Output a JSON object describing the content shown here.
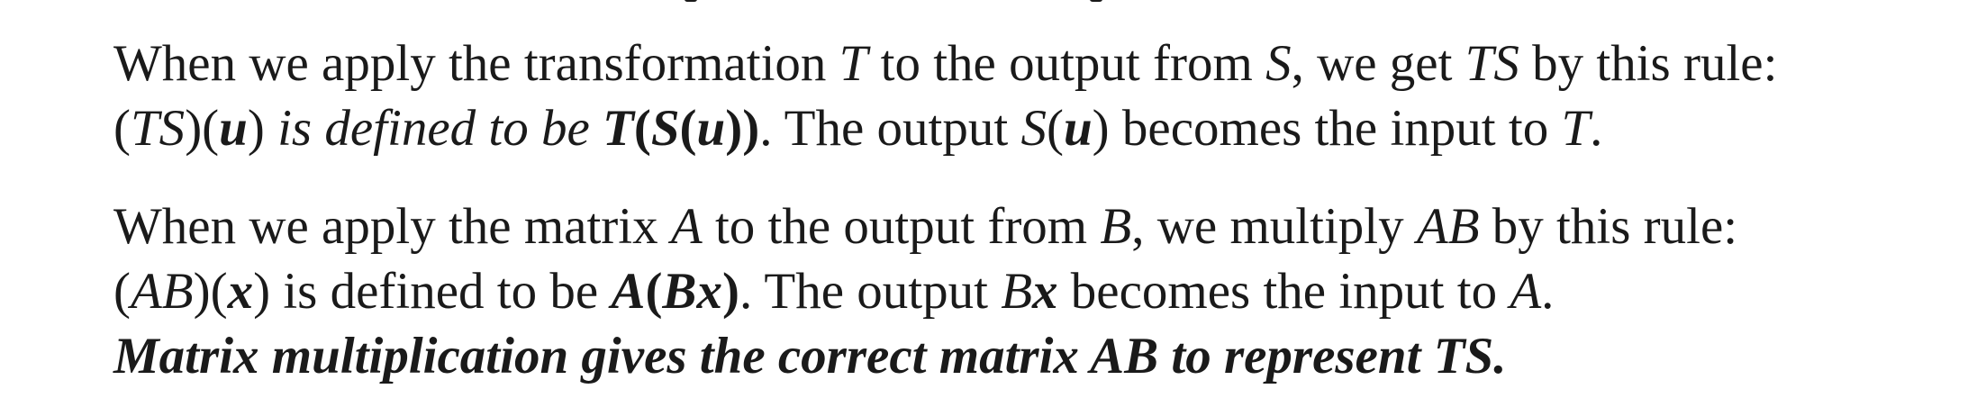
{
  "paragraph_1": {
    "line_1": {
      "a": "When we apply the transformation ",
      "T": "T",
      "b": " to the output from ",
      "S": "S",
      "c": ", we get ",
      "TS": "TS",
      "d": " by this rule:"
    },
    "line_2": {
      "paren_open": "(",
      "TS": "TS",
      "paren_close": ")(",
      "u": "u",
      "paren_end": ")",
      "defined": " is defined to be ",
      "T_bold": "T",
      "open2": "(",
      "S_bold": "S",
      "open3": "(",
      "u2": "u",
      "close3": "))",
      "rest": ". The output ",
      "S": "S",
      "open4": "(",
      "u3": "u",
      "close4": ")",
      "rest2": " becomes the input to ",
      "T": "T",
      "end": "."
    }
  },
  "paragraph_2": {
    "line_3": {
      "a": "When we apply the matrix ",
      "A": "A",
      "b": " to the output from ",
      "B": "B",
      "c": ", we multiply ",
      "AB": "AB",
      "d": " by this rule:"
    },
    "line_4": {
      "open": "(",
      "AB": "AB",
      "mid": ")(",
      "x": "x",
      "close": ")",
      "defined": " is defined to be ",
      "A_bold": "A",
      "open2": "(",
      "B_bold": "B",
      "x_bold": "x",
      "close2": ")",
      "rest": ". The output ",
      "B": "B",
      "x2": "x",
      "rest2": " becomes the input to ",
      "A": "A",
      "end": "."
    },
    "line_5": {
      "a": "Matrix multiplication gives the correct matrix ",
      "AB": "AB",
      "b": " to represent ",
      "TS": "TS",
      "end": "."
    }
  }
}
